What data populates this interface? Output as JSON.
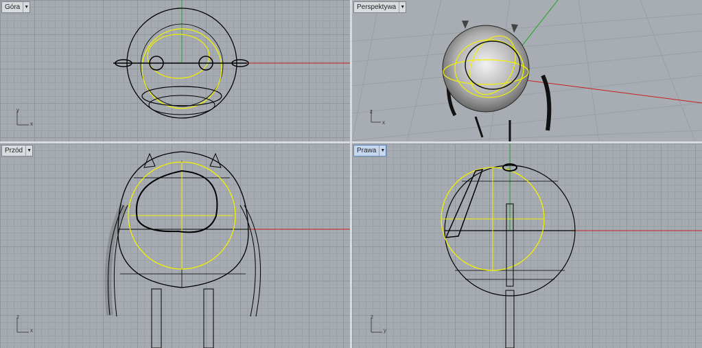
{
  "viewports": {
    "top": {
      "label": "Góra"
    },
    "perspective": {
      "label": "Perspektywa"
    },
    "front": {
      "label": "Przód"
    },
    "right": {
      "label": "Prawa"
    }
  },
  "axis_labels": {
    "x": "x",
    "y": "y",
    "z": "z"
  },
  "colors": {
    "viewport_bg": "#a6abb1",
    "selection": "#f2f200",
    "x_axis": "#c81e1e",
    "y_axis": "#1fa01f",
    "wire": "#000000",
    "active_tab": "#c6d8ef"
  },
  "icons": {
    "dropdown": "triangle-down"
  }
}
